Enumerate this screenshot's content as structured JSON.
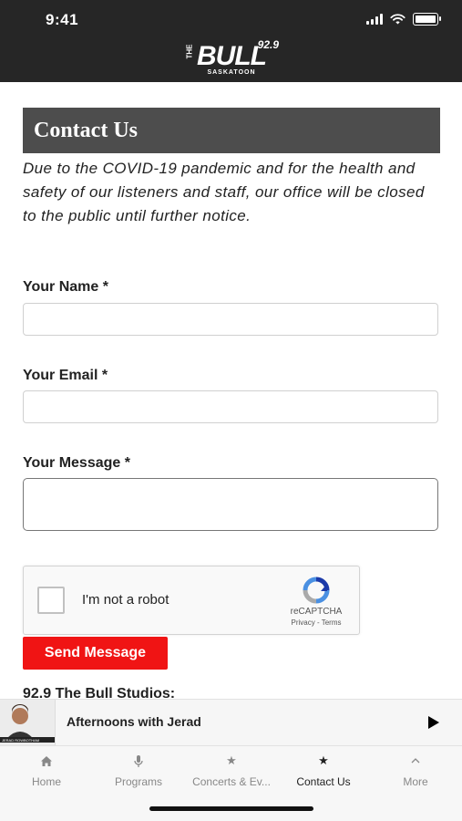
{
  "status_bar": {
    "time": "9:41"
  },
  "logo": {
    "main": "BULL",
    "number": "92.9",
    "the": "THE",
    "city": "SASKATOON"
  },
  "page": {
    "title": "Contact Us",
    "notice": "Due to the COVID-19 pandemic and for the health and safety of our listeners and staff, our office will be closed to the public until further notice."
  },
  "form": {
    "name_label": "Your Name *",
    "email_label": "Your Email *",
    "message_label": "Your Message *",
    "name_value": "",
    "email_value": "",
    "message_value": ""
  },
  "recaptcha": {
    "label": "I'm not a robot",
    "brand": "reCAPTCHA",
    "links": "Privacy - Terms"
  },
  "send_button": "Send Message",
  "studios_heading": "92.9 The Bull Studios:",
  "now_playing": {
    "title": "Afternoons with Jerad",
    "thumb_caption": "JERAD ROWBOTHAM"
  },
  "tabs": [
    {
      "label": "Home",
      "icon": "home-icon",
      "active": false
    },
    {
      "label": "Programs",
      "icon": "microphone-icon",
      "active": false
    },
    {
      "label": "Concerts & Ev...",
      "icon": "star-icon",
      "active": false
    },
    {
      "label": "Contact Us",
      "icon": "star-icon",
      "active": true
    },
    {
      "label": "More",
      "icon": "chevron-up-icon",
      "active": false
    }
  ],
  "colors": {
    "header_bg": "#262626",
    "title_bg": "#4d4d4d",
    "send_button": "#f01414"
  }
}
